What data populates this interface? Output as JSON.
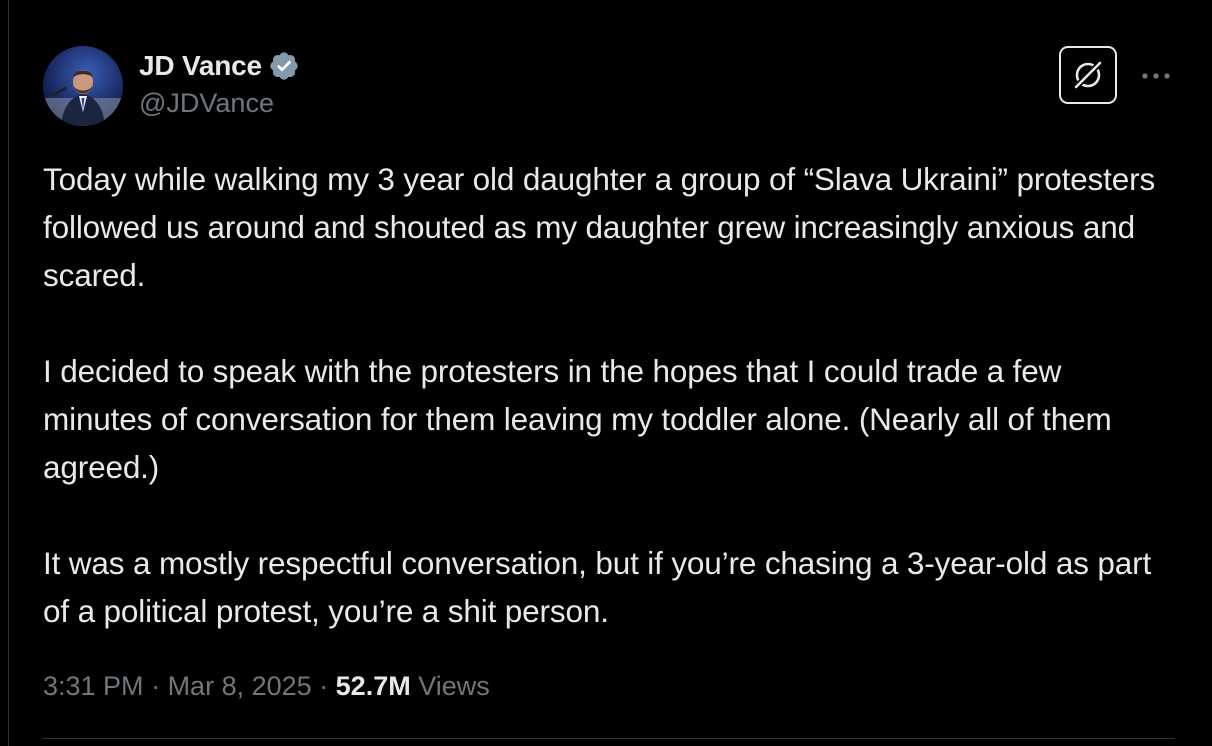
{
  "author": {
    "display_name": "JD Vance",
    "handle": "@JDVance",
    "verified": true,
    "avatar_icon": "profile-photo"
  },
  "actions": {
    "grok_icon": "grok-icon",
    "more_icon": "more-options-icon"
  },
  "tweet": {
    "paragraphs": [
      "Today while walking my 3 year old daughter a group of “Slava Ukraini” protesters followed us around and shouted as my daughter grew increasingly anxious and scared.",
      "I decided to speak with the protesters in the hopes that I could trade a few minutes of conversation for them leaving my toddler alone. (Nearly all of them agreed.)",
      "It was a mostly respectful conversation,  but if you’re chasing a 3-year-old as part of a political protest, you’re a shit person."
    ]
  },
  "meta": {
    "time": "3:31 PM",
    "separator": " · ",
    "date": "Mar 8, 2025",
    "views_count": "52.7M",
    "views_label": "Views"
  },
  "colors": {
    "background": "#000000",
    "primary_text": "#e7e9ea",
    "secondary_text": "#71767b",
    "verified_badge": "#829aab",
    "divider": "#2f3336"
  }
}
